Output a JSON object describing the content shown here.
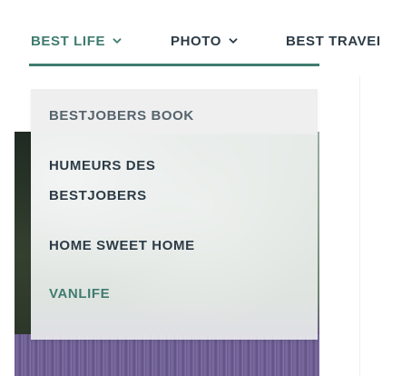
{
  "nav": {
    "items": [
      {
        "label": "BEST LIFE",
        "has_chevron": true,
        "active": true
      },
      {
        "label": "PHOTO",
        "has_chevron": true,
        "active": false
      },
      {
        "label": "BEST TRAVEI",
        "has_chevron": false,
        "active": false
      }
    ]
  },
  "dropdown": {
    "items": [
      {
        "label": "BESTJOBERS BOOK"
      },
      {
        "label_line1": "HUMEURS DES",
        "label_line2": "BESTJOBERS"
      },
      {
        "label": "HOME SWEET HOME"
      },
      {
        "label": "VANLIFE"
      }
    ]
  },
  "colors": {
    "accent": "#3f7c6f",
    "text": "#2c3b46",
    "muted_text": "#55646d",
    "dropdown_bg": "#f2f4f3"
  },
  "icons": {
    "chevron": "chevron-down-icon"
  }
}
